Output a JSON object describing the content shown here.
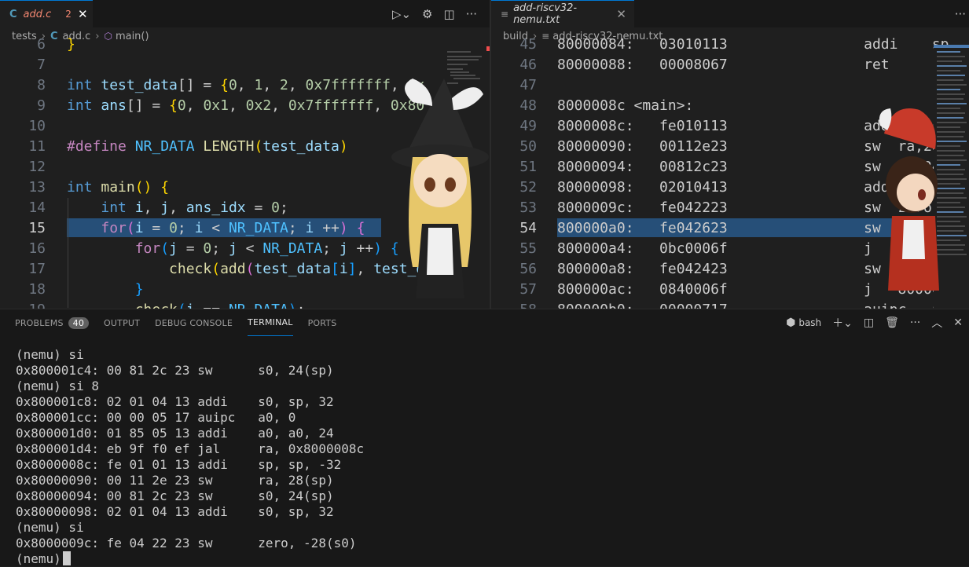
{
  "left_editor": {
    "tab": {
      "filename": "add.c",
      "problems": "2"
    },
    "breadcrumb": [
      "tests",
      "add.c",
      "main()"
    ],
    "active_line": "15",
    "lines": [
      {
        "n": "6",
        "parts": [
          [
            "}",
            "br1"
          ]
        ]
      },
      {
        "n": "7",
        "parts": []
      },
      {
        "n": "8",
        "parts": [
          [
            "int",
            "kw"
          ],
          [
            " ",
            ""
          ],
          [
            "test_data",
            "var"
          ],
          [
            "[] = ",
            ""
          ],
          [
            "{",
            "br1"
          ],
          [
            "0",
            "num"
          ],
          [
            ", ",
            ""
          ],
          [
            "1",
            "num"
          ],
          [
            ", ",
            ""
          ],
          [
            "2",
            "num"
          ],
          [
            ", ",
            ""
          ],
          [
            "0x7fffffff",
            "num"
          ],
          [
            ", ",
            ""
          ],
          [
            "0x",
            "num"
          ]
        ]
      },
      {
        "n": "9",
        "parts": [
          [
            "int",
            "kw"
          ],
          [
            " ",
            ""
          ],
          [
            "ans",
            "var"
          ],
          [
            "[] = ",
            ""
          ],
          [
            "{",
            "br1"
          ],
          [
            "0",
            "num"
          ],
          [
            ", ",
            ""
          ],
          [
            "0x1",
            "num"
          ],
          [
            ", ",
            ""
          ],
          [
            "0x2",
            "num"
          ],
          [
            ", ",
            ""
          ],
          [
            "0x7fffffff",
            "num"
          ],
          [
            ", ",
            ""
          ],
          [
            "0x80",
            "num"
          ]
        ]
      },
      {
        "n": "10",
        "parts": []
      },
      {
        "n": "11",
        "parts": [
          [
            "#define",
            "ctl"
          ],
          [
            " ",
            ""
          ],
          [
            "NR_DATA",
            "mac"
          ],
          [
            " ",
            ""
          ],
          [
            "LENGTH",
            "fn"
          ],
          [
            "(",
            "br1"
          ],
          [
            "test_data",
            "var"
          ],
          [
            ")",
            "br1"
          ]
        ]
      },
      {
        "n": "12",
        "parts": []
      },
      {
        "n": "13",
        "parts": [
          [
            "int",
            "kw"
          ],
          [
            " ",
            ""
          ],
          [
            "main",
            "fn"
          ],
          [
            "()",
            "br1"
          ],
          [
            " ",
            ""
          ],
          [
            "{",
            "br1"
          ]
        ]
      },
      {
        "n": "14",
        "parts": [
          [
            "    ",
            ""
          ],
          [
            "int",
            "kw"
          ],
          [
            " ",
            ""
          ],
          [
            "i",
            "var"
          ],
          [
            ", ",
            ""
          ],
          [
            "j",
            "var"
          ],
          [
            ", ",
            ""
          ],
          [
            "ans_idx",
            "var"
          ],
          [
            " = ",
            ""
          ],
          [
            "0",
            "num"
          ],
          [
            ";",
            ""
          ]
        ]
      },
      {
        "n": "15",
        "parts": [
          [
            "    ",
            ""
          ],
          [
            "for",
            "ctl"
          ],
          [
            "(",
            "br2"
          ],
          [
            "i",
            "var"
          ],
          [
            " = ",
            ""
          ],
          [
            "0",
            "num"
          ],
          [
            "; ",
            ""
          ],
          [
            "i",
            "var"
          ],
          [
            " < ",
            ""
          ],
          [
            "NR_DATA",
            "mac"
          ],
          [
            "; ",
            ""
          ],
          [
            "i",
            "var"
          ],
          [
            " ++",
            ""
          ],
          [
            ")",
            "br2"
          ],
          [
            " ",
            ""
          ],
          [
            "{",
            "br2"
          ]
        ]
      },
      {
        "n": "16",
        "parts": [
          [
            "        ",
            ""
          ],
          [
            "for",
            "ctl"
          ],
          [
            "(",
            "br3"
          ],
          [
            "j",
            "var"
          ],
          [
            " = ",
            ""
          ],
          [
            "0",
            "num"
          ],
          [
            "; ",
            ""
          ],
          [
            "j",
            "var"
          ],
          [
            " < ",
            ""
          ],
          [
            "NR_DATA",
            "mac"
          ],
          [
            "; ",
            ""
          ],
          [
            "j",
            "var"
          ],
          [
            " ++",
            ""
          ],
          [
            ")",
            "br3"
          ],
          [
            " ",
            ""
          ],
          [
            "{",
            "br3"
          ]
        ]
      },
      {
        "n": "17",
        "parts": [
          [
            "            ",
            ""
          ],
          [
            "check",
            "fn"
          ],
          [
            "(",
            "br1"
          ],
          [
            "add",
            "fn"
          ],
          [
            "(",
            "br2"
          ],
          [
            "test_data",
            "var"
          ],
          [
            "[",
            "br3"
          ],
          [
            "i",
            "var"
          ],
          [
            "]",
            "br3"
          ],
          [
            ", ",
            ""
          ],
          [
            "test_d",
            "var"
          ]
        ]
      },
      {
        "n": "18",
        "parts": [
          [
            "        ",
            ""
          ],
          [
            "}",
            "br3"
          ]
        ]
      },
      {
        "n": "19",
        "parts": [
          [
            "        ",
            ""
          ],
          [
            "check",
            "fn"
          ],
          [
            "(",
            "br3"
          ],
          [
            "i",
            "var"
          ],
          [
            " == ",
            ""
          ],
          [
            "NR_DATA",
            "mac"
          ],
          [
            ")",
            "br3"
          ],
          [
            ";",
            ""
          ]
        ]
      }
    ]
  },
  "right_editor": {
    "tab": {
      "filename": "add-riscv32-nemu.txt"
    },
    "breadcrumb": [
      "build",
      "add-riscv32-nemu.txt"
    ],
    "active_line": "54",
    "lines": [
      {
        "n": "45",
        "text": "80000084:   03010113                addi    sp"
      },
      {
        "n": "46",
        "text": "80000088:   00008067                ret"
      },
      {
        "n": "47",
        "text": ""
      },
      {
        "n": "48",
        "text": "8000008c <main>:"
      },
      {
        "n": "49",
        "text": "8000008c:   fe010113                addi    sp"
      },
      {
        "n": "50",
        "text": "80000090:   00112e23                sw  ra,28"
      },
      {
        "n": "51",
        "text": "80000094:   00812c23                sw  s0,24"
      },
      {
        "n": "52",
        "text": "80000098:   02010413                addi    s0"
      },
      {
        "n": "53",
        "text": "8000009c:   fe042223                sw  zero,"
      },
      {
        "n": "54",
        "text": "800000a0:   fe042623                sw  zero,"
      },
      {
        "n": "55",
        "text": "800000a4:   0bc0006f                j   800001"
      },
      {
        "n": "56",
        "text": "800000a8:   fe042423                sw  zero,"
      },
      {
        "n": "57",
        "text": "800000ac:   0840006f                j   800001"
      },
      {
        "n": "58",
        "text": "800000b0:   00000717                auipc   a"
      }
    ]
  },
  "panel": {
    "tabs": [
      {
        "label": "PROBLEMS",
        "badge": "40"
      },
      {
        "label": "OUTPUT"
      },
      {
        "label": "DEBUG CONSOLE"
      },
      {
        "label": "TERMINAL"
      },
      {
        "label": "PORTS"
      }
    ],
    "active_tab": "TERMINAL",
    "shell": "bash",
    "terminal_lines": [
      "(nemu) si",
      "0x800001c4: 00 81 2c 23 sw      s0, 24(sp)",
      "(nemu) si 8",
      "0x800001c8: 02 01 04 13 addi    s0, sp, 32",
      "0x800001cc: 00 00 05 17 auipc   a0, 0",
      "0x800001d0: 01 85 05 13 addi    a0, a0, 24",
      "0x800001d4: eb 9f f0 ef jal     ra, 0x8000008c",
      "0x8000008c: fe 01 01 13 addi    sp, sp, -32",
      "0x80000090: 00 11 2e 23 sw      ra, 28(sp)",
      "0x80000094: 00 81 2c 23 sw      s0, 24(sp)",
      "0x80000098: 02 01 04 13 addi    s0, sp, 32",
      "(nemu) si",
      "0x8000009c: fe 04 22 23 sw      zero, -28(s0)"
    ],
    "prompt": "(nemu)"
  },
  "icons": {
    "run": "run-debug-icon",
    "settings": "gear-icon",
    "split": "split-editor-icon",
    "more": "more-actions-icon",
    "close": "close-icon",
    "terminal_add": "plus-icon",
    "trash": "trash-icon",
    "maximize": "chevron-up-icon"
  },
  "colors": {
    "accent": "#0078d4",
    "line_highlight": "#264f78",
    "error": "#f48771"
  }
}
